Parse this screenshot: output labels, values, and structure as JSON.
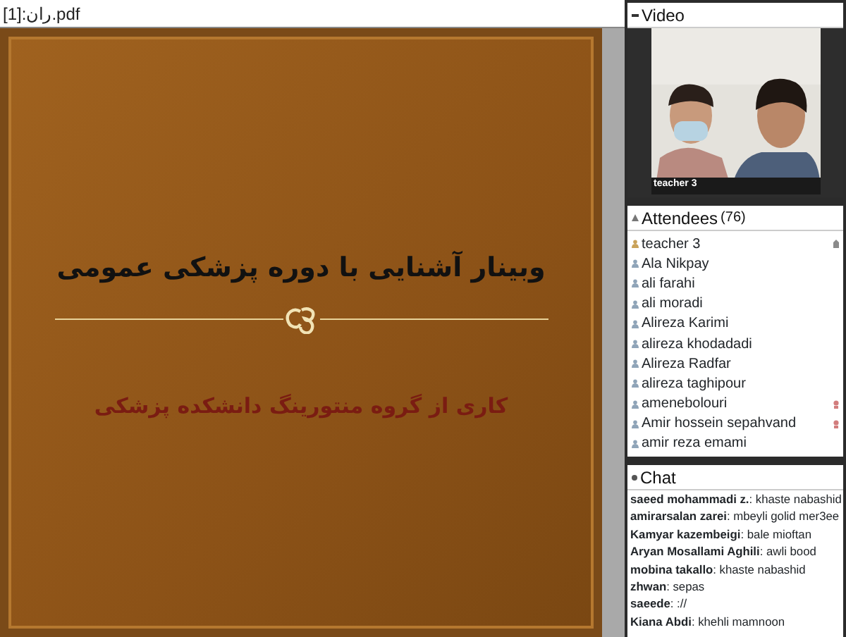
{
  "document": {
    "title": "ران:[1].pdf",
    "slide": {
      "title": "وبینار آشنایی با دوره پزشکی عمومی",
      "subtitle": "کاری از گروه منتورینگ دانشکده پزشکی"
    }
  },
  "video": {
    "title": "Video",
    "expanded": true,
    "caption": "teacher 3"
  },
  "attendees": {
    "title": "Attendees",
    "count": "(76)",
    "expanded": true,
    "items": [
      {
        "name": "teacher 3",
        "kind": "host",
        "hand_raised": true,
        "flagged": false
      },
      {
        "name": "Ala Nikpay",
        "kind": "participant",
        "hand_raised": false,
        "flagged": false
      },
      {
        "name": "ali farahi",
        "kind": "participant",
        "hand_raised": false,
        "flagged": false
      },
      {
        "name": "ali moradi",
        "kind": "participant",
        "hand_raised": false,
        "flagged": false
      },
      {
        "name": "Alireza Karimi",
        "kind": "participant",
        "hand_raised": false,
        "flagged": false
      },
      {
        "name": "alireza khodadadi",
        "kind": "participant",
        "hand_raised": false,
        "flagged": false
      },
      {
        "name": "Alireza Radfar",
        "kind": "participant",
        "hand_raised": false,
        "flagged": false
      },
      {
        "name": "alireza taghipour",
        "kind": "participant",
        "hand_raised": false,
        "flagged": false
      },
      {
        "name": "amenebolouri",
        "kind": "participant",
        "hand_raised": false,
        "flagged": true
      },
      {
        "name": "Amir hossein sepahvand",
        "kind": "participant",
        "hand_raised": false,
        "flagged": true
      },
      {
        "name": "amir reza emami",
        "kind": "participant",
        "hand_raised": false,
        "flagged": false
      }
    ]
  },
  "chat": {
    "title": "Chat",
    "expanded": true,
    "messages": [
      "**saeed mohammadi z.**: khaste nabashid",
      "**amirarsalan zarei**: mbeyli golid mer3ee",
      "**Kamyar kazembeigi**: bale mioftan",
      "**Aryan Mosallami Aghili**: awli bood",
      "**mobina takallo**: khaste nabashid",
      "**zhwan**: sepas",
      "**saeede**: ://",
      "**Kiana Abdi**: khehli mamnoon"
    ]
  }
}
